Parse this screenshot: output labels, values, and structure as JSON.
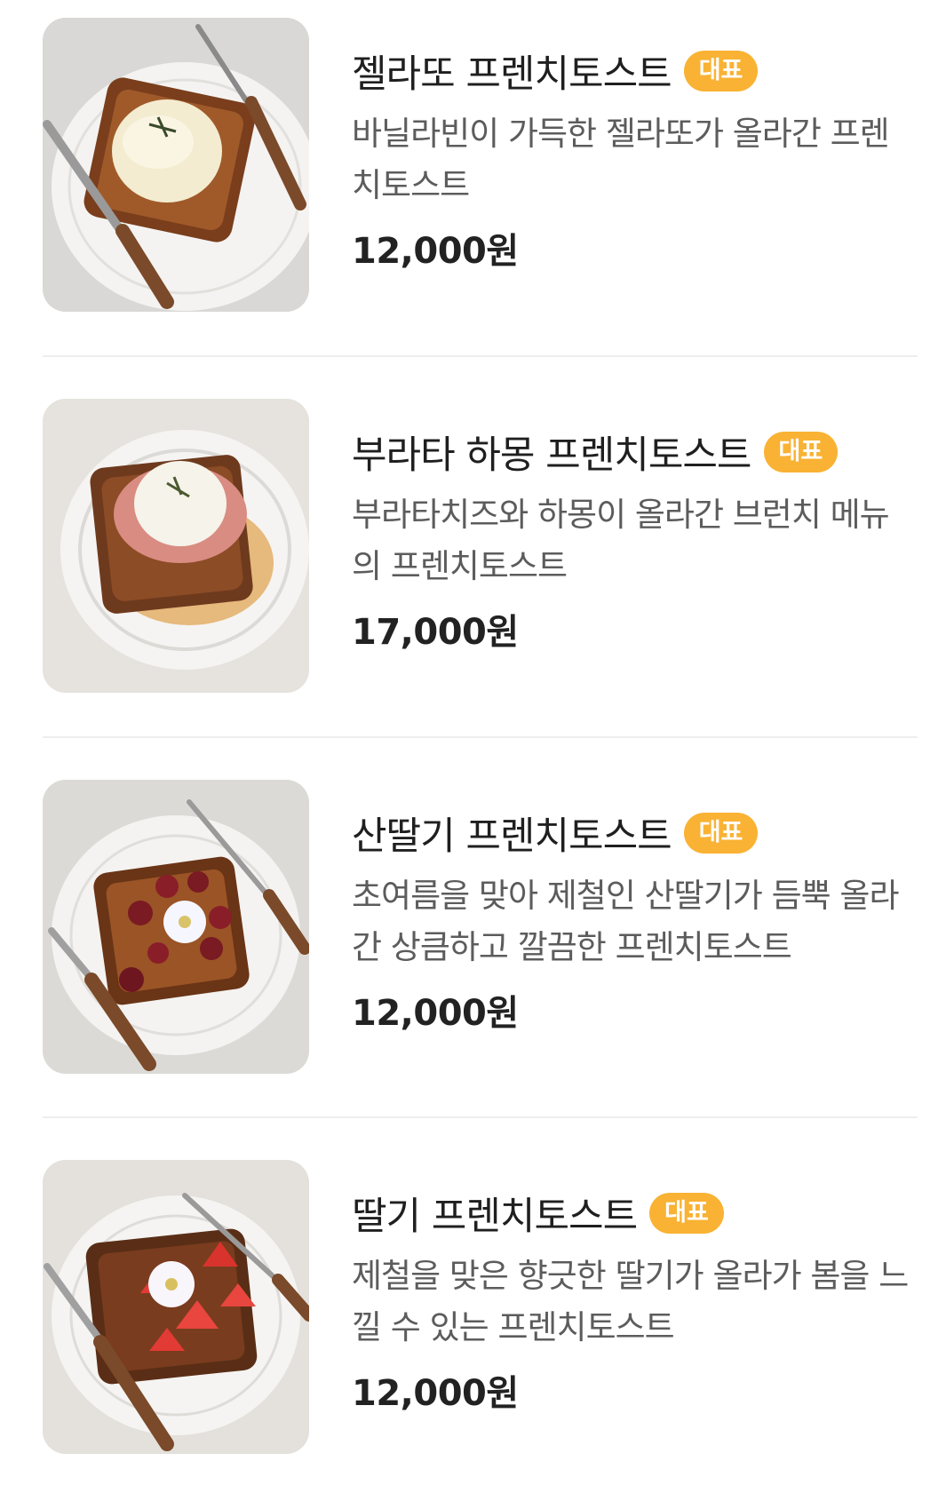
{
  "menu": {
    "items": [
      {
        "name": "젤라또 프렌치토스트",
        "badge": "대표",
        "description": "바닐라빈이 가득한 젤라또가 올라간 프렌치토스트",
        "price": "12,000원",
        "photo_icon": "gelato-french-toast-photo"
      },
      {
        "name": "부라타 하몽 프렌치토스트",
        "badge": "대표",
        "description": "부라타치즈와 하몽이 올라간 브런치 메뉴의 프렌치토스트",
        "price": "17,000원",
        "photo_icon": "burrata-jamon-french-toast-photo"
      },
      {
        "name": "산딸기 프렌치토스트",
        "badge": "대표",
        "description": "초여름을 맞아 제철인 산딸기가 듬뿍 올라간 상큼하고 깔끔한 프렌치토스트",
        "price": "12,000원",
        "photo_icon": "raspberry-french-toast-photo"
      },
      {
        "name": "딸기 프렌치토스트",
        "badge": "대표",
        "description": "제철을 맞은 향긋한 딸기가 올라가 봄을 느낄 수 있는 프렌치토스트",
        "price": "12,000원",
        "photo_icon": "strawberry-french-toast-photo"
      }
    ]
  },
  "colors": {
    "badge_bg": "#f9b233",
    "name_text": "#1f1f1f",
    "desc_text": "#5c5c5c",
    "price_text": "#222222",
    "divider": "#eeeeee"
  }
}
